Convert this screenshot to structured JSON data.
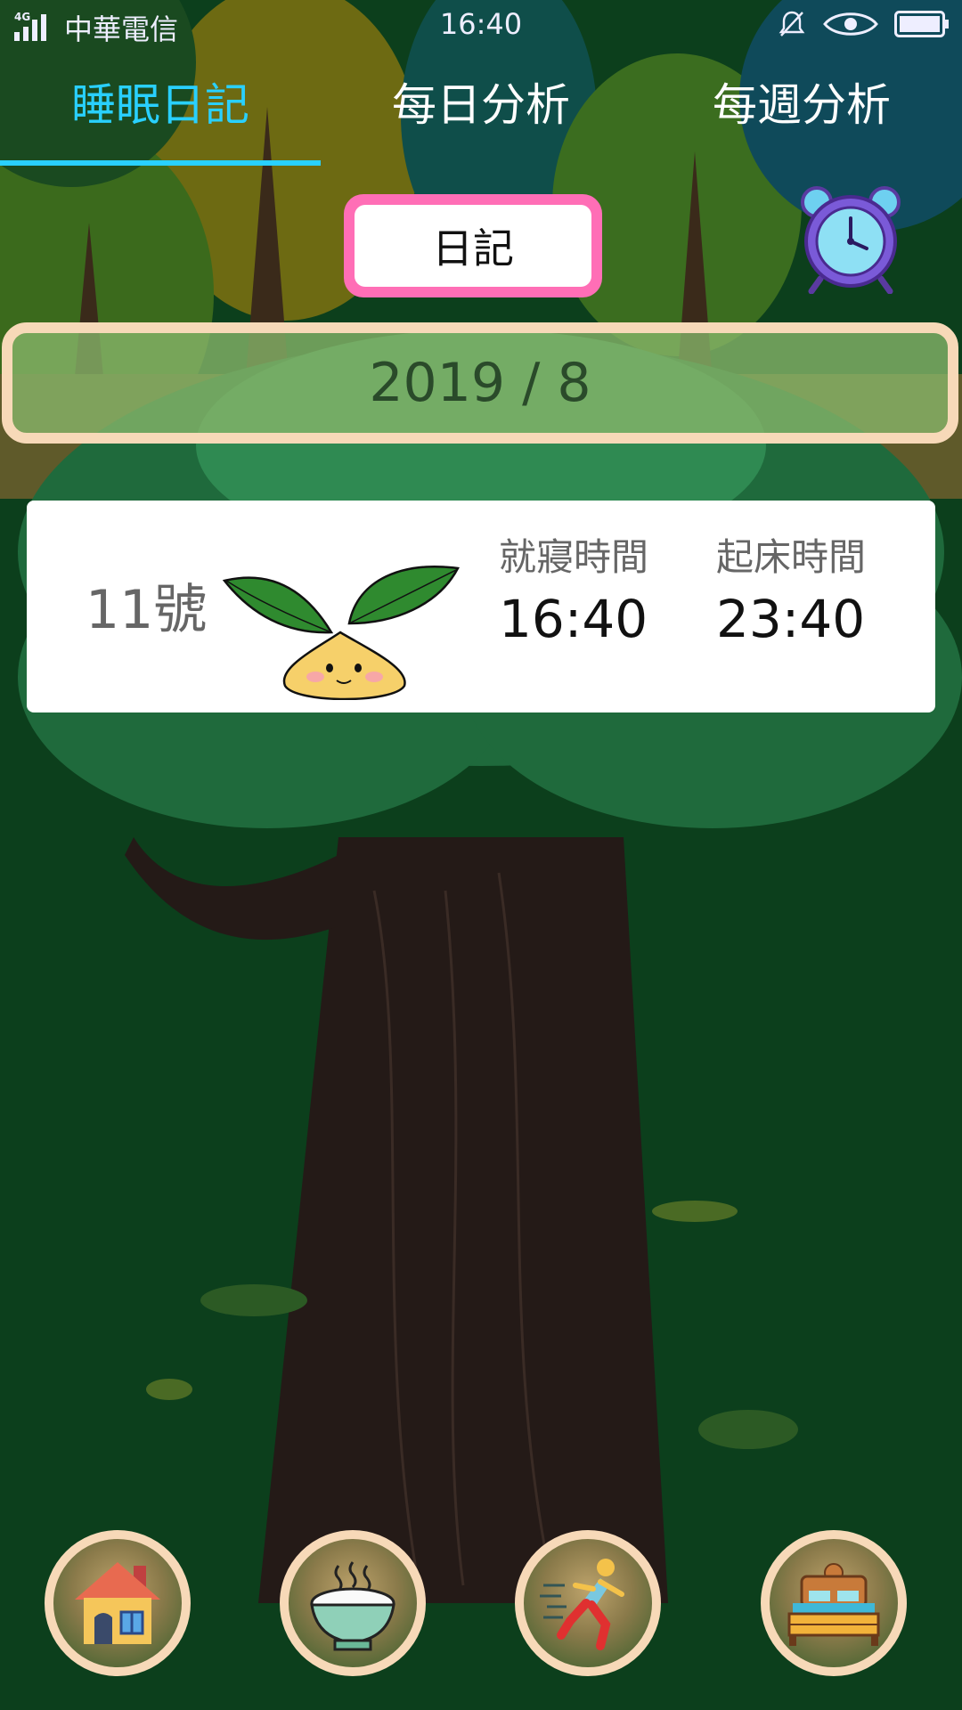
{
  "status_bar": {
    "network": "4G",
    "carrier": "中華電信",
    "time": "16:40"
  },
  "tabs": [
    {
      "label": "睡眠日記",
      "active": true
    },
    {
      "label": "每日分析",
      "active": false
    },
    {
      "label": "每週分析",
      "active": false
    }
  ],
  "diary_button": {
    "label": "日記"
  },
  "month_selector": {
    "label": "2019 / 8"
  },
  "record": {
    "day": "11號",
    "bedtime_label": "就寢時間",
    "bedtime": "16:40",
    "wakeup_label": "起床時間",
    "wakeup": "23:40"
  },
  "bottom_nav": [
    {
      "icon": "home-icon"
    },
    {
      "icon": "rice-bowl-icon"
    },
    {
      "icon": "running-icon"
    },
    {
      "icon": "bed-icon"
    }
  ],
  "colors": {
    "accent": "#29d0ff",
    "diary_border": "#ff6eb6",
    "month_border": "#f7d9b8"
  }
}
